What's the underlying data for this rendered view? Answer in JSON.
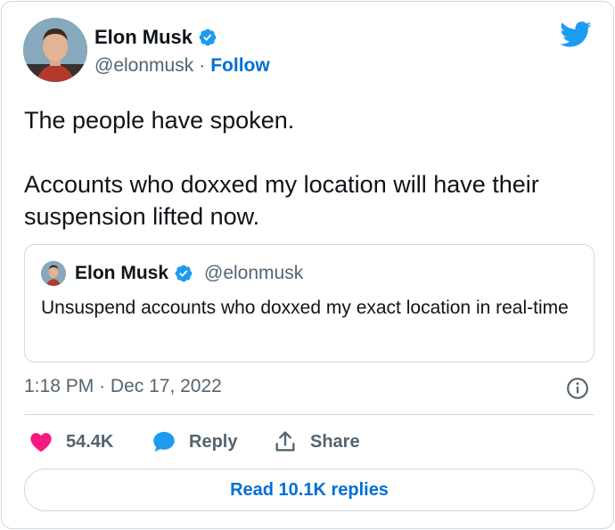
{
  "author": {
    "name": "Elon Musk",
    "handle": "@elonmusk",
    "separator": "·",
    "follow_label": "Follow"
  },
  "tweet": {
    "text": "The people have spoken.\n\nAccounts who doxxed my location will have their suspension lifted now."
  },
  "quoted_tweet": {
    "name": "Elon Musk",
    "handle": "@elonmusk",
    "text": "Unsuspend accounts who doxxed my exact location in real-time"
  },
  "meta": {
    "time": "1:18 PM",
    "separator": "·",
    "date": "Dec 17, 2022"
  },
  "actions": {
    "like_count": "54.4K",
    "reply_label": "Reply",
    "share_label": "Share"
  },
  "replies_button_label": "Read 10.1K replies",
  "icons": {
    "verified": "verified-badge-icon",
    "brand": "twitter-bird-icon",
    "info": "info-icon",
    "like": "heart-icon",
    "reply": "speech-bubble-icon",
    "share": "share-upload-icon"
  },
  "colors": {
    "accent": "#1d9bf0",
    "link": "#006fd6",
    "like": "#f91880",
    "text": "#0f1419",
    "muted": "#536471",
    "border": "#cfd9de"
  }
}
